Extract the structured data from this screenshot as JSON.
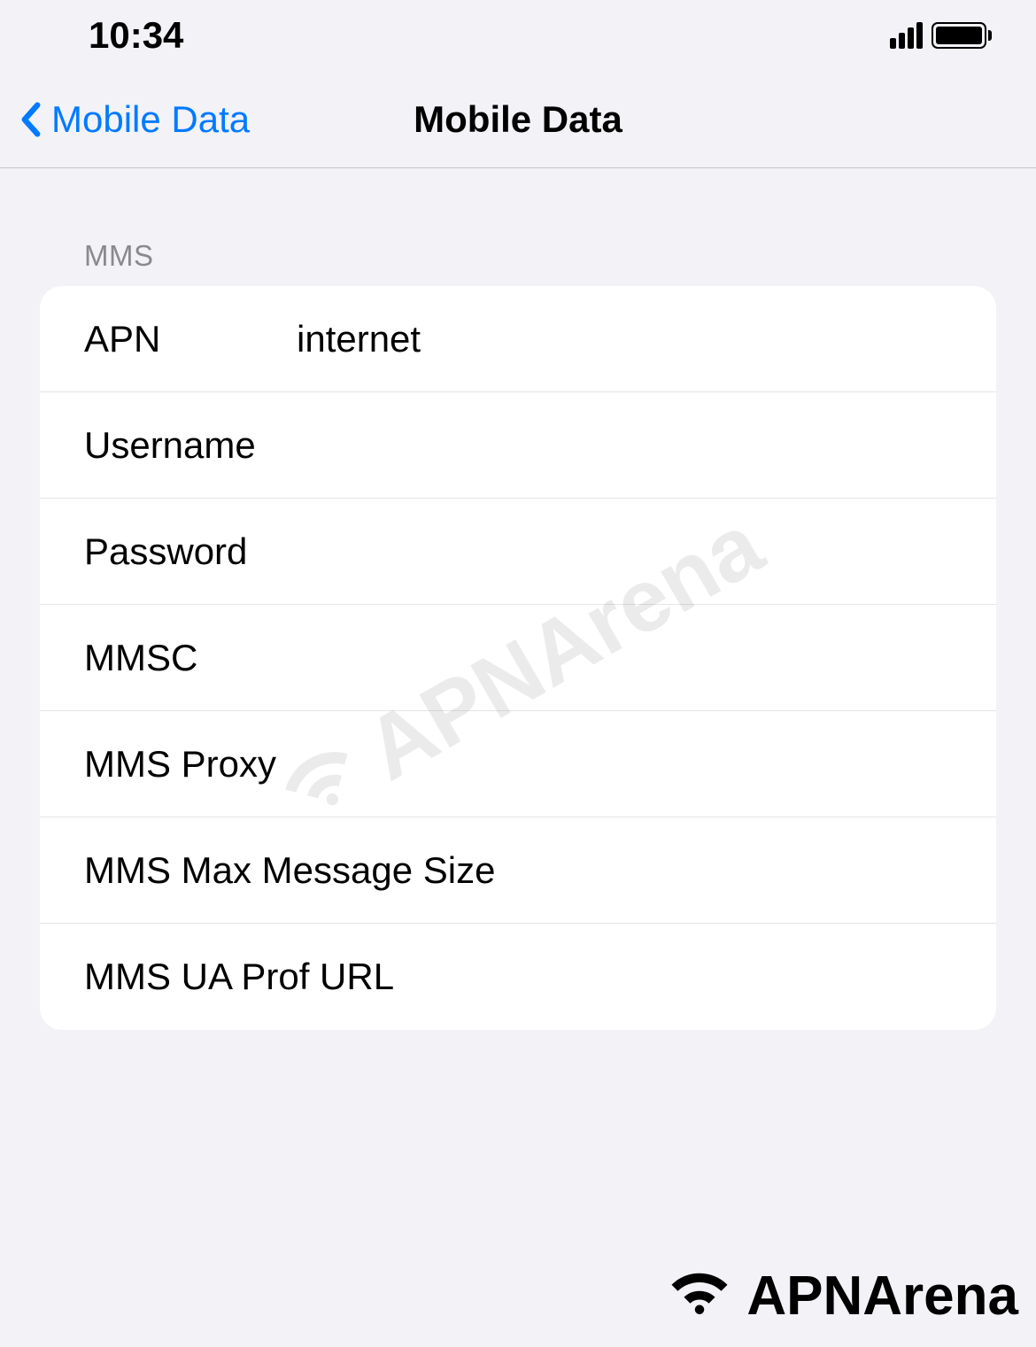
{
  "status_bar": {
    "time": "10:34"
  },
  "nav": {
    "back_label": "Mobile Data",
    "title": "Mobile Data"
  },
  "section": {
    "header": "MMS",
    "rows": [
      {
        "label": "APN",
        "value": "internet"
      },
      {
        "label": "Username",
        "value": ""
      },
      {
        "label": "Password",
        "value": ""
      },
      {
        "label": "MMSC",
        "value": ""
      },
      {
        "label": "MMS Proxy",
        "value": ""
      },
      {
        "label": "MMS Max Message Size",
        "value": ""
      },
      {
        "label": "MMS UA Prof URL",
        "value": ""
      }
    ]
  },
  "watermark": "APNArena",
  "footer_logo": "APNArena"
}
